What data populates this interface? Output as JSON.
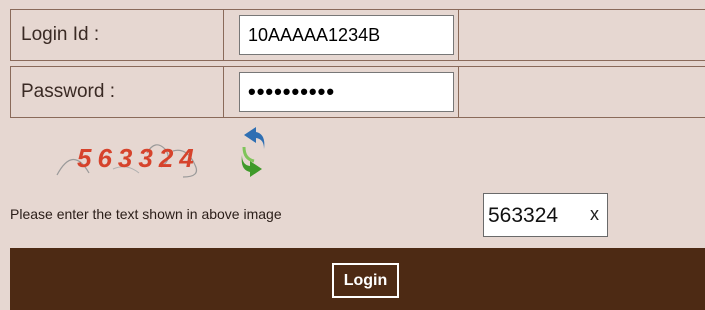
{
  "form": {
    "login_id_label": "Login Id :",
    "login_id_value": "10AAAAA1234B",
    "password_label": "Password :",
    "password_value": "**********",
    "captcha_text": "563324",
    "captcha_prompt": "Please enter the text shown in above image",
    "captcha_input_value": "563324",
    "clear_glyph": "x",
    "login_button_label": "Login"
  },
  "colors": {
    "panel_background": "#e6d7d1",
    "border": "#8a6a5a",
    "footer_bar": "#4d2a14",
    "captcha_digits": "#d6432c",
    "refresh_blue": "#2f6fb3",
    "refresh_green": "#3f9a2a"
  },
  "icons": {
    "refresh": "refresh-captcha-icon",
    "clear": "clear-icon"
  }
}
